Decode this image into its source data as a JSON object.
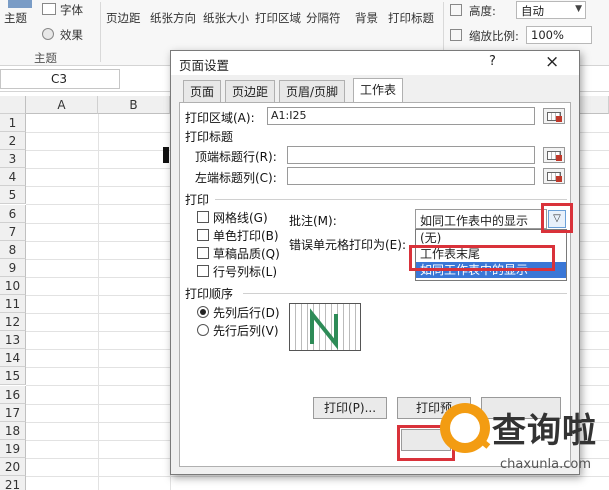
{
  "ribbon": {
    "theme_label": "主题",
    "theme_group_label": "主题",
    "font_label": "字体",
    "effects_label": "效果",
    "margins_label": "页边距",
    "orientation_label": "纸张方向",
    "size_label": "纸张大小",
    "print_area_label": "打印区域",
    "breaks_label": "分隔符",
    "background_label": "背景",
    "print_titles_label": "打印标题",
    "height_label": "高度:",
    "height_value": "自动",
    "scale_label": "缩放比例:",
    "scale_value": "100%"
  },
  "formula_bar": {
    "name_box": "C3"
  },
  "sheet": {
    "columns": [
      "A",
      "B"
    ],
    "rows": [
      "1",
      "2",
      "3",
      "4",
      "5",
      "6",
      "7",
      "8",
      "9",
      "10",
      "11",
      "12",
      "13",
      "14",
      "15",
      "16",
      "17",
      "18",
      "19",
      "20",
      "21"
    ]
  },
  "dialog": {
    "title": "页面设置",
    "help": "?",
    "close": "×",
    "tabs": [
      "页面",
      "页边距",
      "页眉/页脚",
      "工作表"
    ],
    "active_tab": "工作表",
    "print_area_label": "打印区域(A):",
    "print_area_value": "A1:I25",
    "print_titles_label": "打印标题",
    "rows_repeat_label": "顶端标题行(R):",
    "cols_repeat_label": "左端标题列(C):",
    "print_label": "打印",
    "gridlines": "网格线(G)",
    "black_white": "单色打印(B)",
    "draft": "草稿品质(Q)",
    "headings": "行号列标(L)",
    "comments_label": "批注(M):",
    "comments_value": "如同工作表中的显示",
    "errors_label": "错误单元格打印为(E):",
    "comments_options": [
      "(无)",
      "工作表末尾",
      "如同工作表中的显示"
    ],
    "order_label": "打印顺序",
    "down_then_over": "先列后行(D)",
    "over_then_down": "先行后列(V)",
    "print_button": "打印(P)...",
    "preview_button": "打印预"
  },
  "watermark": {
    "main": "查询啦",
    "sub": "chaxunla.com"
  },
  "colors": {
    "highlight": "#3a77d6",
    "annotation_red": "#d9323a",
    "brand_orange": "#f39c12"
  }
}
